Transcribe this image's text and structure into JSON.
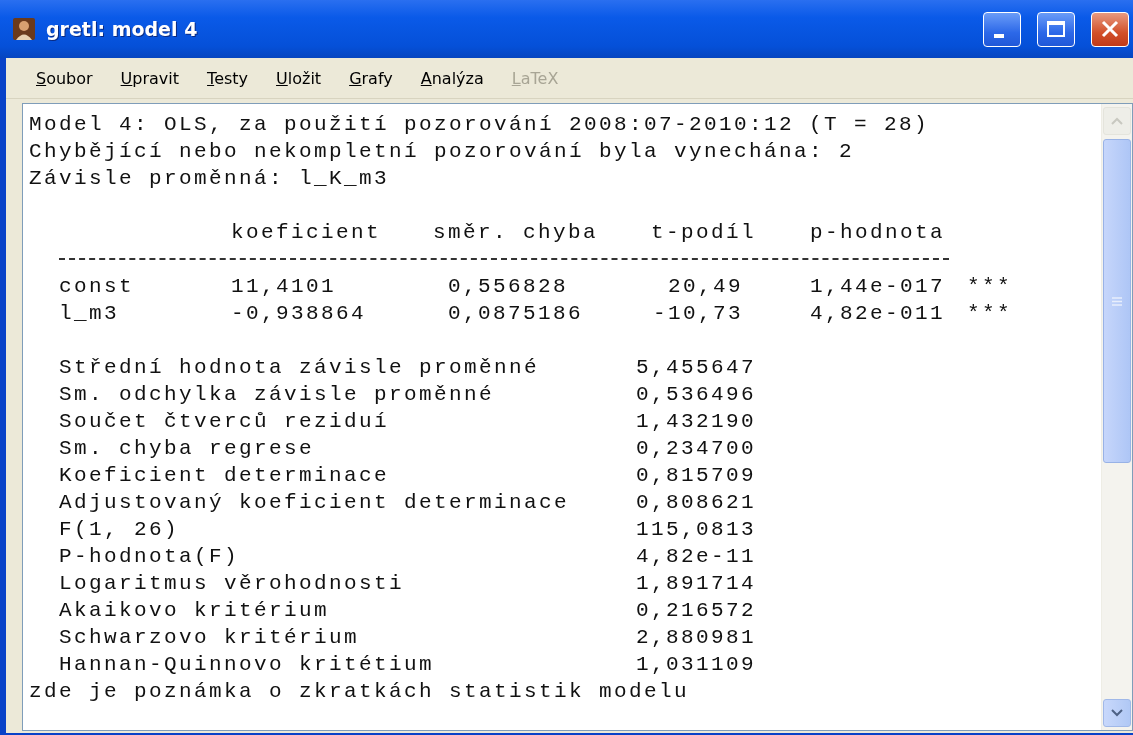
{
  "window": {
    "title": "gretl: model 4"
  },
  "menu": [
    {
      "label": "Soubor",
      "disabled": false
    },
    {
      "label": "Upravit",
      "disabled": false
    },
    {
      "label": "Testy",
      "disabled": false
    },
    {
      "label": "Uložit",
      "disabled": false
    },
    {
      "label": "Grafy",
      "disabled": false
    },
    {
      "label": "Analýza",
      "disabled": false
    },
    {
      "label": "LaTeX",
      "disabled": true
    }
  ],
  "output": {
    "header_lines": [
      "Model 4: OLS, za použití pozorování 2008:07-2010:12 (T = 28)",
      "Chybějící nebo nekompletní pozorování byla vynechána: 2",
      "Závisle proměnná: l_K_m3"
    ],
    "coefficients": {
      "columns": [
        "koeficient",
        "směr. chyba",
        "t-podíl",
        "p-hodnota"
      ],
      "rows": [
        {
          "name": "const",
          "coef": "11,4101",
          "std_error": "0,556828",
          "t_ratio": "20,49",
          "p_value": "1,44e-017",
          "significance": "***"
        },
        {
          "name": "l_m3",
          "coef": "-0,938864",
          "std_error": "0,0875186",
          "t_ratio": "-10,73",
          "p_value": "4,82e-011",
          "significance": "***"
        }
      ]
    },
    "statistics": [
      {
        "label": "Střední hodnota závisle proměnné",
        "value": "5,455647"
      },
      {
        "label": "Sm. odchylka závisle proměnné",
        "value": "0,536496"
      },
      {
        "label": "Součet čtverců reziduí",
        "value": "1,432190"
      },
      {
        "label": "Sm. chyba regrese",
        "value": "0,234700"
      },
      {
        "label": "Koeficient determinace",
        "value": "0,815709"
      },
      {
        "label": "Adjustovaný koeficient determinace",
        "value": "0,808621"
      },
      {
        "label": "F(1, 26)",
        "value": "115,0813"
      },
      {
        "label": "P-hodnota(F)",
        "value": "4,82e-11"
      },
      {
        "label": "Logaritmus věrohodnosti",
        "value": "1,891714"
      },
      {
        "label": "Akaikovo kritérium",
        "value": "0,216572"
      },
      {
        "label": "Schwarzovo kritérium",
        "value": "2,880981"
      },
      {
        "label": "Hannan-Quinnovo kritétium",
        "value": "1,031109"
      }
    ],
    "note": "zde je poznámka o zkratkách statistik modelu"
  }
}
